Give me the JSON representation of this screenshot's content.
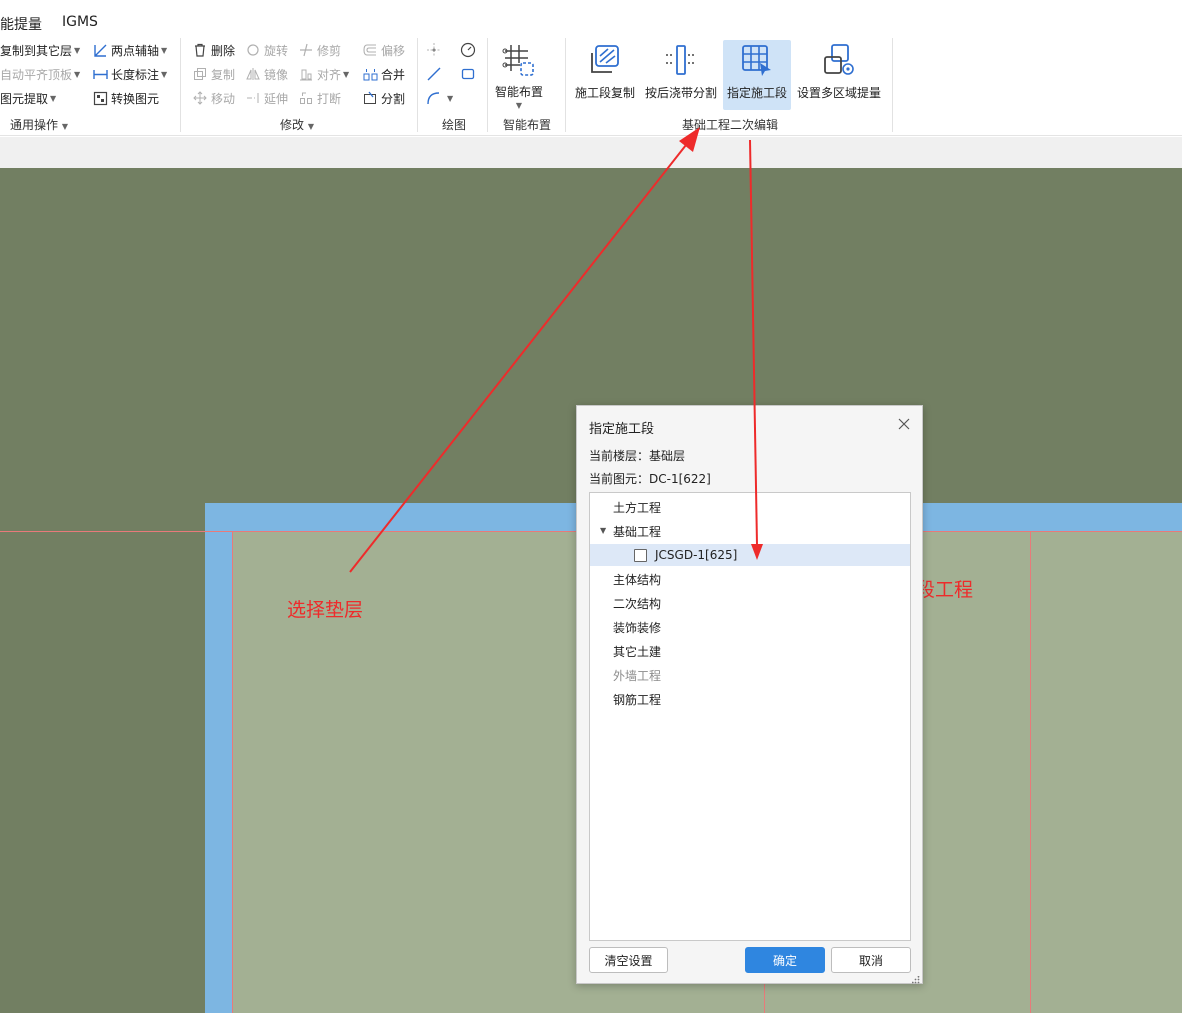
{
  "menu_tabs": [
    "能提量",
    "IGMS"
  ],
  "ribbon": {
    "general": {
      "title": "通用操作",
      "copy_to_floor": "复制到其它层",
      "auto_align_top": "自动平齐顶板",
      "extract_element": "图元提取",
      "two_point_axis": "两点辅轴",
      "length_dim": "长度标注",
      "convert_element": "转换图元"
    },
    "modify": {
      "title": "修改",
      "delete": "删除",
      "rotate": "旋转",
      "trim": "修剪",
      "offset": "偏移",
      "copy": "复制",
      "mirror": "镜像",
      "align": "对齐",
      "merge": "合并",
      "move": "移动",
      "extend": "延伸",
      "break": "打断",
      "split": "分割"
    },
    "draw": {
      "title": "绘图"
    },
    "smart_layout": {
      "title": "智能布置",
      "button": "智能布置"
    },
    "foundation_edit": {
      "title": "基础工程二次编辑",
      "segment_copy": "施工段复制",
      "post_pour_split": "按后浇带分割",
      "assign_segment": "指定施工段",
      "multi_zone_quantity": "设置多区域提量"
    }
  },
  "annotations": {
    "select_cushion": "选择垫层",
    "check_segment": "勾选指定的施工段工程"
  },
  "dialog": {
    "title": "指定施工段",
    "current_floor": "当前楼层：基础层",
    "current_element": "当前图元：DC-1[622]",
    "tree": [
      {
        "label": "土方工程",
        "level": 0
      },
      {
        "label": "基础工程",
        "level": 0,
        "expanded": true
      },
      {
        "label": "JCSGD-1[625]",
        "level": 1,
        "checkbox": true,
        "checked": false,
        "selected": true
      },
      {
        "label": "主体结构",
        "level": 0
      },
      {
        "label": "二次结构",
        "level": 0
      },
      {
        "label": "装饰装修",
        "level": 0
      },
      {
        "label": "其它土建",
        "level": 0
      },
      {
        "label": "外墙工程",
        "level": 0,
        "disabled": true
      },
      {
        "label": "钢筋工程",
        "level": 0
      }
    ],
    "clear_button": "清空设置",
    "ok_button": "确定",
    "cancel_button": "取消"
  },
  "colors": {
    "canvas": "#727f62",
    "slab_border": "#7db6e2",
    "slab": "#a3b093",
    "annotation": "#ee2b2b",
    "primary": "#2f86e0"
  }
}
